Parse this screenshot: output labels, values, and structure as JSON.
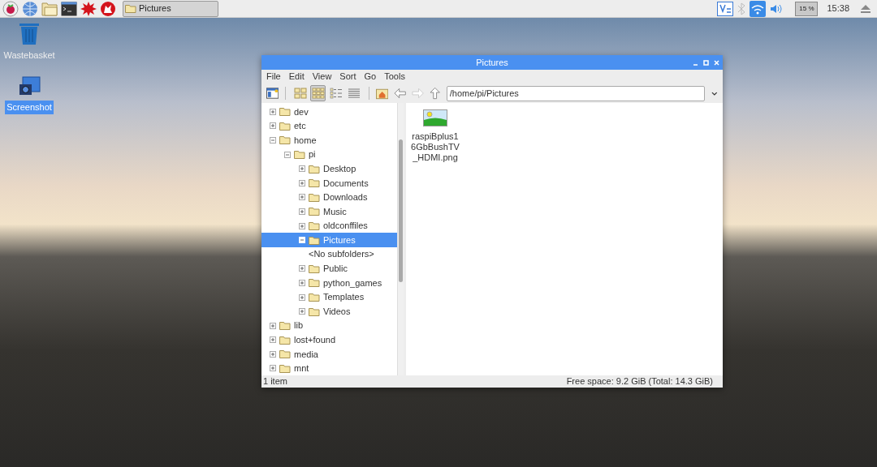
{
  "taskbar": {
    "launchers": [
      {
        "kind": "menu"
      },
      {
        "kind": "browser"
      },
      {
        "kind": "files"
      },
      {
        "kind": "terminal"
      },
      {
        "kind": "burst"
      },
      {
        "kind": "math"
      }
    ],
    "tasks": [
      {
        "label": "Pictures",
        "selected": true
      }
    ],
    "tray": {
      "cpu": "15 %",
      "clock": "15:38"
    }
  },
  "desktop_icons": [
    {
      "kind": "trash",
      "label": "Wastebasket",
      "selected": false
    },
    {
      "kind": "screenshot",
      "label": "Screenshot",
      "selected": true
    }
  ],
  "window": {
    "title": "Pictures",
    "menu": [
      "File",
      "Edit",
      "View",
      "Sort",
      "Go",
      "Tools"
    ],
    "view_modes": [
      {
        "kind": "thumbnail",
        "selected": false
      },
      {
        "kind": "icon",
        "selected": true
      },
      {
        "kind": "compact",
        "selected": false
      },
      {
        "kind": "list",
        "selected": false
      }
    ],
    "path": "/home/pi/Pictures",
    "tree": [
      {
        "label": "dev",
        "expanded": false,
        "selected": false
      },
      {
        "label": "etc",
        "expanded": false,
        "selected": false
      },
      {
        "label": "home",
        "expanded": true,
        "selected": false,
        "children": [
          {
            "label": "pi",
            "expanded": true,
            "selected": false,
            "children": [
              {
                "label": "Desktop",
                "expanded": false,
                "selected": false
              },
              {
                "label": "Documents",
                "expanded": false,
                "selected": false
              },
              {
                "label": "Downloads",
                "expanded": false,
                "selected": false
              },
              {
                "label": "Music",
                "expanded": false,
                "selected": false
              },
              {
                "label": "oldconffiles",
                "expanded": false,
                "selected": false
              },
              {
                "label": "Pictures",
                "expanded": true,
                "selected": true,
                "children": [
                  {
                    "kind": "placeholder",
                    "label": "<No subfolders>"
                  }
                ]
              },
              {
                "label": "Public",
                "expanded": false,
                "selected": false
              },
              {
                "label": "python_games",
                "expanded": false,
                "selected": false
              },
              {
                "label": "Templates",
                "expanded": false,
                "selected": false
              },
              {
                "label": "Videos",
                "expanded": false,
                "selected": false
              }
            ]
          }
        ]
      },
      {
        "label": "lib",
        "expanded": false,
        "selected": false
      },
      {
        "label": "lost+found",
        "expanded": false,
        "selected": false
      },
      {
        "label": "media",
        "expanded": false,
        "selected": false
      },
      {
        "label": "mnt",
        "expanded": false,
        "selected": false
      }
    ],
    "files": [
      {
        "kind": "image",
        "name": "raspiBplus1\n6GbBushTV\n_HDMI.png"
      }
    ],
    "status": {
      "count": "1 item",
      "free_space": "Free space: 9.2 GiB (Total: 14.3 GiB)"
    }
  }
}
